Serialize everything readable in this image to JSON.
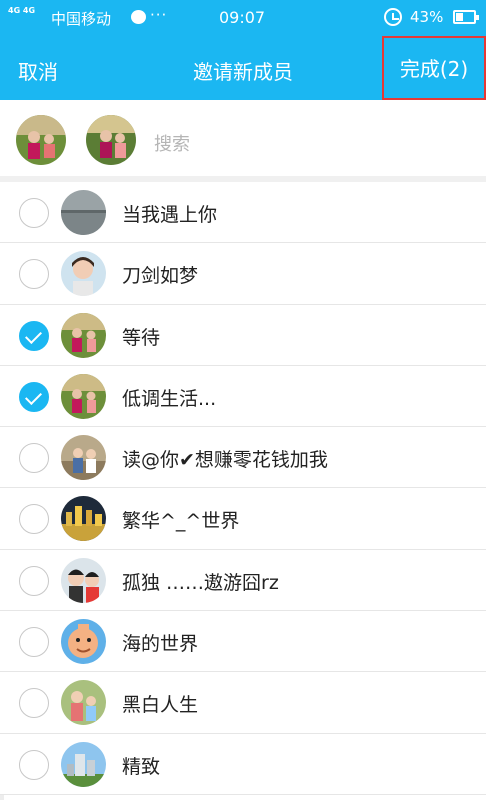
{
  "status_bar": {
    "signal_text": "4G 4G",
    "carrier": "中国移动",
    "more": "···",
    "time": "09:07",
    "battery_pct": "43%",
    "battery_level": 0.43
  },
  "nav": {
    "cancel_label": "取消",
    "title": "邀请新成员",
    "done_label": "完成(2)"
  },
  "selected": {
    "avatars": [
      "avatar-photo-family",
      "avatar-photo-family"
    ],
    "search_placeholder": "搜索"
  },
  "contacts": [
    {
      "name": "当我遇上你",
      "checked": false,
      "avatar": "gray-lake-photo"
    },
    {
      "name": "刀剑如梦",
      "checked": false,
      "avatar": "child-portrait-photo"
    },
    {
      "name": "等待",
      "checked": true,
      "avatar": "family-photo"
    },
    {
      "name": "低调生活...",
      "checked": true,
      "avatar": "family-photo"
    },
    {
      "name": "读@你✔想赚零花钱加我",
      "checked": false,
      "avatar": "people-photo"
    },
    {
      "name": "繁华^_^世界",
      "checked": false,
      "avatar": "city-night-photo"
    },
    {
      "name": "孤独 ……遨游囧rz",
      "checked": false,
      "avatar": "couple-photo"
    },
    {
      "name": "海的世界",
      "checked": false,
      "avatar": "cartoon-face"
    },
    {
      "name": "黑白人生",
      "checked": false,
      "avatar": "family-photo-2"
    },
    {
      "name": "精致",
      "checked": false,
      "avatar": "building-photo"
    }
  ],
  "colors": {
    "brand_blue": "#1bb7f2",
    "highlight_red": "#e53935"
  }
}
